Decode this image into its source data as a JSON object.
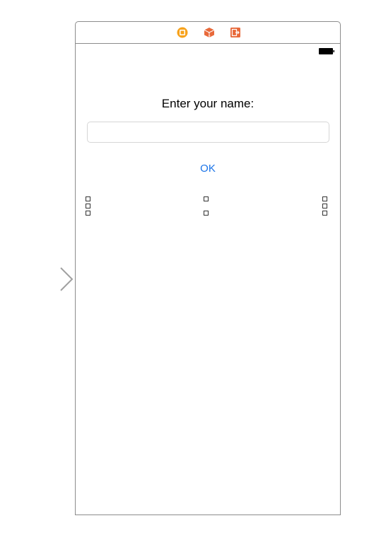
{
  "scene": {
    "dock_icons": [
      "view-controller-icon",
      "first-responder-icon",
      "exit-icon"
    ],
    "status_bar": {
      "battery_icon": "battery-icon"
    },
    "prompt_label": "Enter your name:",
    "name_field": {
      "value": "",
      "placeholder": ""
    },
    "ok_button_label": "OK"
  },
  "colors": {
    "frame_border": "#8c8c8c",
    "dock_vc_icon": "#f7a21b",
    "dock_fr_icon": "#e8693a",
    "dock_exit_icon": "#e8693a",
    "button_tint": "#1a73e8",
    "entry_arrow": "#a0a0a0"
  }
}
